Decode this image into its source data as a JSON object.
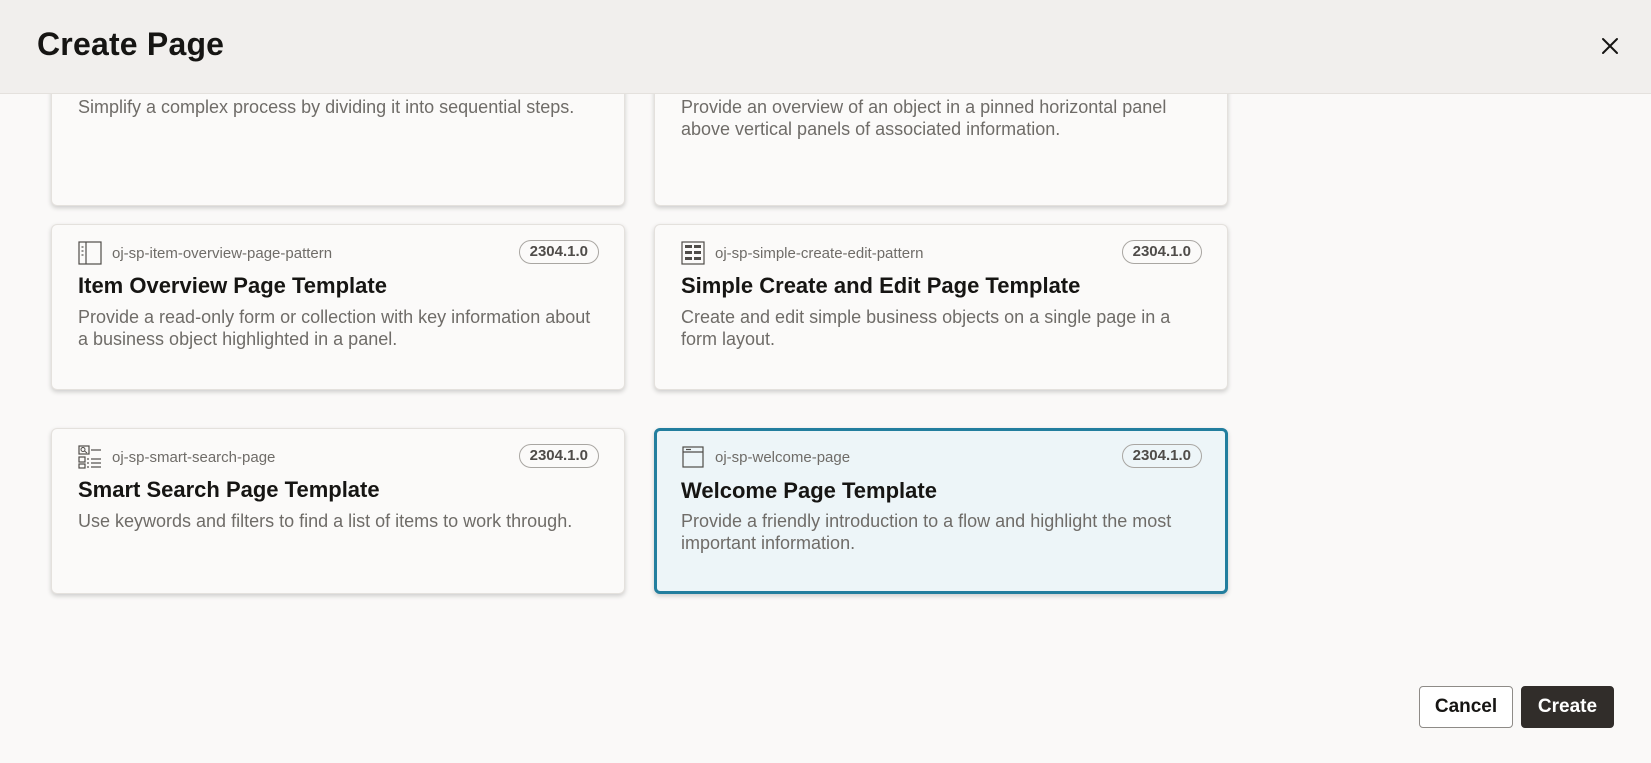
{
  "dialog": {
    "title": "Create Page",
    "close_icon": "close-icon"
  },
  "templates": [
    {
      "description": "Simplify a complex process by dividing it into sequential steps."
    },
    {
      "description": "Provide an overview of an object in a pinned horizontal panel above vertical panels of associated information."
    },
    {
      "icon": "item-overview-icon",
      "slug": "oj-sp-item-overview-page-pattern",
      "version": "2304.1.0",
      "title": "Item Overview Page Template",
      "description": "Provide a read-only form or collection with key information about a business object highlighted in a panel."
    },
    {
      "icon": "simple-create-edit-icon",
      "slug": "oj-sp-simple-create-edit-pattern",
      "version": "2304.1.0",
      "title": "Simple Create and Edit Page Template",
      "description": "Create and edit simple business objects on a single page in a form layout."
    },
    {
      "icon": "smart-search-icon",
      "slug": "oj-sp-smart-search-page",
      "version": "2304.1.0",
      "title": "Smart Search Page Template",
      "description": "Use keywords and filters to find a list of items to work through."
    },
    {
      "icon": "welcome-page-icon",
      "slug": "oj-sp-welcome-page",
      "version": "2304.1.0",
      "title": "Welcome Page Template",
      "description": "Provide a friendly introduction to a flow and highlight the most important information.",
      "selected": true
    }
  ],
  "footer": {
    "cancel_label": "Cancel",
    "create_label": "Create"
  },
  "colors": {
    "selected_border": "#227e9e",
    "selected_bg": "#edf5f8",
    "primary_button": "#312d2a"
  }
}
